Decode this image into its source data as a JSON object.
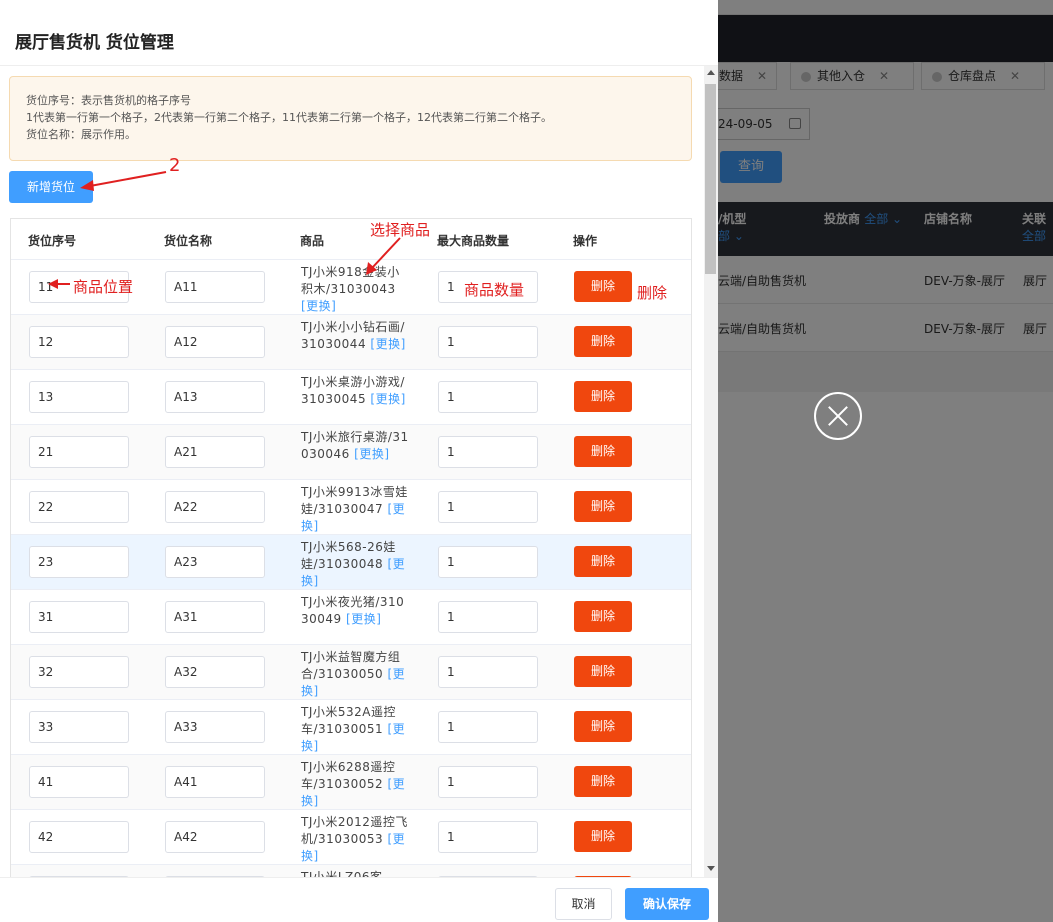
{
  "background": {
    "tabs": [
      {
        "label": "数据"
      },
      {
        "label": "其他入仓"
      },
      {
        "label": "仓库盘点"
      }
    ],
    "date_value": "24-09-05",
    "query_label": "查询",
    "table_headers": {
      "model": "/机型",
      "model_sub": "部 ⌄",
      "investor": "投放商",
      "investor_filter": "全部 ⌄",
      "shop": "店铺名称",
      "related": "关联",
      "related_sub": "全部"
    },
    "rows": [
      {
        "model": "云端/自助售货机",
        "shop": "DEV-万象-展厅",
        "extra": "展厅"
      },
      {
        "model": "云端/自助售货机",
        "shop": "DEV-万象-展厅",
        "extra": "展厅"
      }
    ]
  },
  "drawer": {
    "title": "展厅售货机 货位管理",
    "notice": {
      "line1": "货位序号：表示售货机的格子序号",
      "line2": "1代表第一行第一个格子，2代表第一行第二个格子，11代表第二行第一个格子，12代表第二行第二个格子。",
      "line3": "货位名称：展示作用。"
    },
    "add_button": "新增货位",
    "columns": {
      "seq": "货位序号",
      "name": "货位名称",
      "product": "商品",
      "max_qty": "最大商品数量",
      "action": "操作"
    },
    "rows": [
      {
        "seq": "11",
        "name": "A11",
        "product": "TJ小米918金装小积木/31030043",
        "change": "[更换]",
        "qty": "1",
        "delete": "删除"
      },
      {
        "seq": "12",
        "name": "A12",
        "product": "TJ小米小小钻石画/31030044",
        "change": "[更换]",
        "qty": "1",
        "delete": "删除"
      },
      {
        "seq": "13",
        "name": "A13",
        "product": "TJ小米桌游小游戏/31030045",
        "change": "[更换]",
        "qty": "1",
        "delete": "删除"
      },
      {
        "seq": "21",
        "name": "A21",
        "product": "TJ小米旅行桌游/31030046",
        "change": "[更换]",
        "qty": "1",
        "delete": "删除"
      },
      {
        "seq": "22",
        "name": "A22",
        "product": "TJ小米9913冰雪娃娃/31030047",
        "change": "[更换]",
        "qty": "1",
        "delete": "删除"
      },
      {
        "seq": "23",
        "name": "A23",
        "product": "TJ小米568-26娃娃/31030048",
        "change": "[更换]",
        "qty": "1",
        "delete": "删除"
      },
      {
        "seq": "31",
        "name": "A31",
        "product": "TJ小米夜光猪/31030049",
        "change": "[更换]",
        "qty": "1",
        "delete": "删除"
      },
      {
        "seq": "32",
        "name": "A32",
        "product": "TJ小米益智魔方组合/31030050",
        "change": "[更换]",
        "qty": "1",
        "delete": "删除"
      },
      {
        "seq": "33",
        "name": "A33",
        "product": "TJ小米532A遥控车/31030051",
        "change": "[更换]",
        "qty": "1",
        "delete": "删除"
      },
      {
        "seq": "41",
        "name": "A41",
        "product": "TJ小米6288遥控车/31030052",
        "change": "[更换]",
        "qty": "1",
        "delete": "删除"
      },
      {
        "seq": "42",
        "name": "A42",
        "product": "TJ小米2012遥控飞机/31030053",
        "change": "[更换]",
        "qty": "1",
        "delete": "删除"
      },
      {
        "seq": "",
        "name": "",
        "product": "TJ小米LZ06客",
        "change": "",
        "qty": "",
        "delete": ""
      }
    ],
    "footer": {
      "cancel": "取消",
      "save": "确认保存"
    }
  },
  "annotations": {
    "step2": "2",
    "select_product": "选择商品",
    "product_position": "商品位置",
    "product_quantity": "商品数量",
    "delete": "删除"
  },
  "colors": {
    "primary": "#409eff",
    "danger": "#f0470e",
    "annotation": "#e02020",
    "notice_bg": "#fdf6ec"
  }
}
